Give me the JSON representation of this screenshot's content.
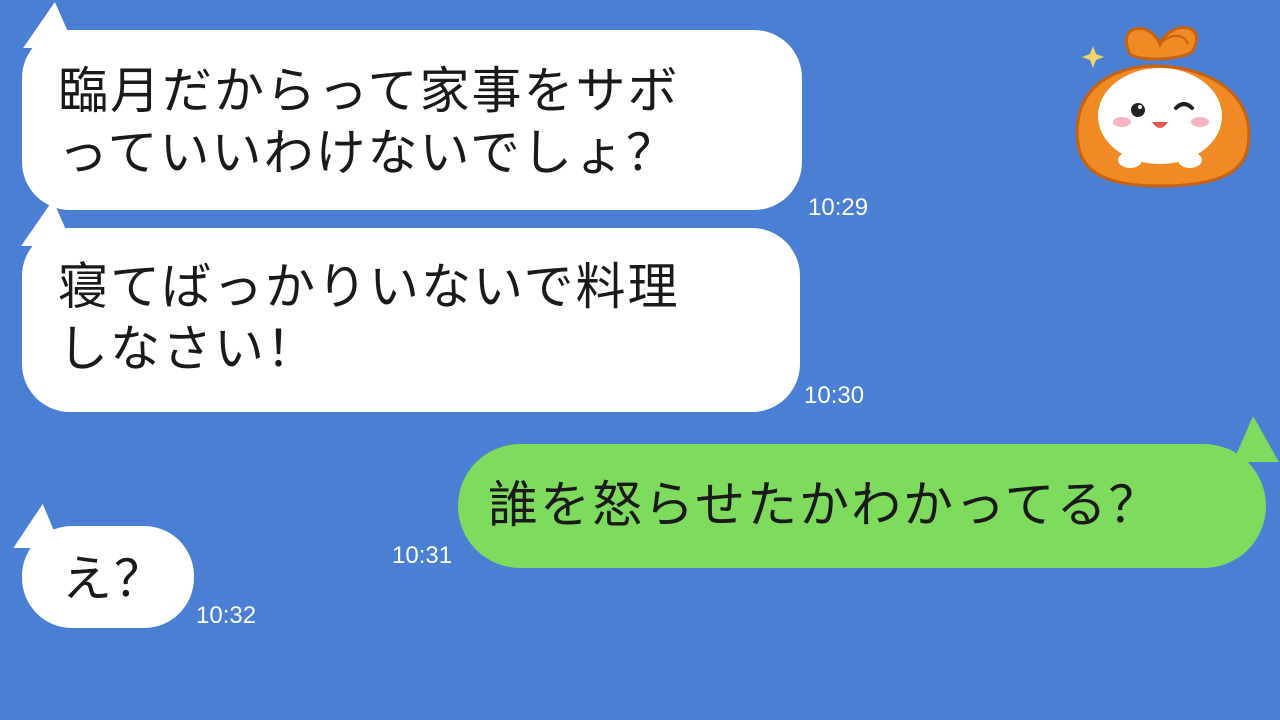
{
  "messages": [
    {
      "side": "incoming",
      "text": "臨月だからって家事をサボ\nっていいわけないでしょ？",
      "time": "10:29"
    },
    {
      "side": "incoming",
      "text": "寝てばっかりいないで料理\nしなさい！",
      "time": "10:30"
    },
    {
      "side": "outgoing",
      "text": "誰を怒らせたかわかってる？",
      "time": "10:31"
    },
    {
      "side": "incoming",
      "text": "え？",
      "time": "10:32"
    }
  ],
  "mascot": {
    "icon": "orange-furoshiki-mascot-icon"
  },
  "colors": {
    "background": "#4a7fd4",
    "incoming_bubble": "#ffffff",
    "outgoing_bubble": "#7edb5e",
    "timestamp": "#ffffff"
  }
}
